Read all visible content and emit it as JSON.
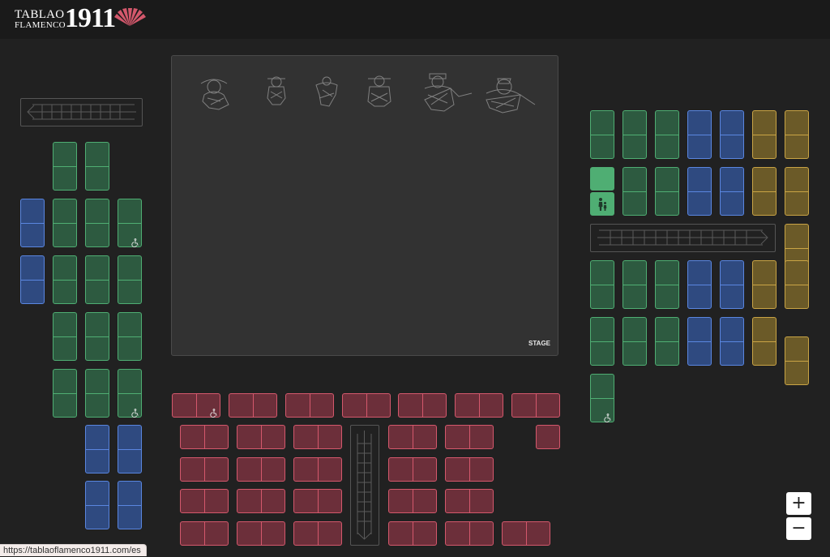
{
  "header": {
    "logo": {
      "line1": "TABLAO",
      "line2": "FLAMENCO",
      "year": "1911",
      "fan_icon": "fan-icon"
    }
  },
  "stage": {
    "label": "STAGE"
  },
  "zoom": {
    "in_label": "+",
    "out_label": "−"
  },
  "status_bar": {
    "url": "https://tablaoflamenco1911.com/es"
  },
  "colors": {
    "green_zone": "#4fae73",
    "blue_zone": "#5a86e0",
    "gold_zone": "#c9a445",
    "red_zone": "#d4586c",
    "background": "#212121",
    "stage": "#323232"
  },
  "icons": {
    "wheelchair": "wheelchair-icon",
    "family": "family-icon",
    "arrow_left": "arrow-left-icon",
    "arrow_right": "arrow-right-icon",
    "arrow_down": "arrow-down-icon"
  }
}
